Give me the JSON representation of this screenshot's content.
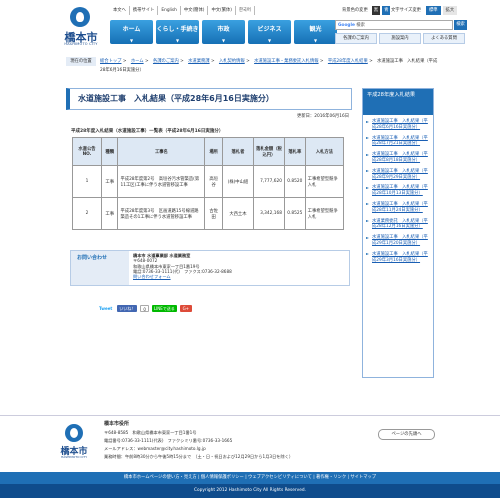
{
  "header": {
    "logo_name": "橋本市",
    "logo_en": "HASHIMOTO CITY",
    "toplinks": [
      "本文へ",
      "携帯サイト",
      "English",
      "中文(簡体)",
      "中文(繁体)",
      "한국어",
      "背景色の変更",
      "黒",
      "青",
      "文字サイズ変更",
      "標準",
      "拡大"
    ],
    "nav": [
      {
        "label": "ホーム",
        "sub": "▼"
      },
      {
        "label": "くらし・手続き",
        "sub": "▼"
      },
      {
        "label": "市政",
        "sub": "▼"
      },
      {
        "label": "ビジネス",
        "sub": "▼"
      },
      {
        "label": "観光",
        "sub": "▼"
      }
    ],
    "search_brand": "Google",
    "search_sub": "検索",
    "search_button": "検索",
    "quick_links": [
      "各課のご案内",
      "施設案内",
      "よくある質問"
    ]
  },
  "breadcrumb": {
    "label": "現在の位置",
    "items": [
      "総合トップ",
      ">",
      "ホーム",
      ">",
      "各課のご案内",
      ">",
      "水道業務課",
      ">",
      "入札契約情報",
      ">",
      "水道施設工事・業務委託入札情報",
      ">",
      "平成28年度入札結果",
      ">",
      "水道施設工事　入札結果（平成28年6月16日実施分）"
    ]
  },
  "main": {
    "title": "水道施設工事　入札結果（平成28年6月16日実施分）",
    "updated": "更新日：2016年06月16日",
    "caption": "平成28年度入札結果（水道施設工事）一覧表（平成28年6月16日実施分）",
    "table": {
      "headers": [
        "水道公告NO.",
        "種類",
        "工事名",
        "場所",
        "落札者",
        "落札金額（税込円）",
        "落札率",
        "入札方法"
      ],
      "rows": [
        [
          "1",
          "工事",
          "平成28年度第2号　高垣谷汚水管築造(第11工区)工事に伴う水道管移設工事",
          "高垣谷",
          "(株)中山組",
          "7,777,620",
          "0.8520",
          "工事希望型競争入札"
        ],
        [
          "2",
          "工事",
          "平成28年度第3号　区画道路15号線道路築造その1工事に伴う水道管移設工事",
          "古佐田",
          "大西土木",
          "3,342,168",
          "0.8525",
          "工事希望型競争入札"
        ]
      ]
    },
    "contact": {
      "heading": "お問い合わせ",
      "dept": "橋本市 水道事業部 水道業務室",
      "zip": "〒648-0072",
      "address": "和歌山県橋本市東家一丁目1番19号",
      "tel": "電話:0736-33-1111(代)　ファクス:0736-32-8688",
      "form": "問い合わせフォーム"
    },
    "social": {
      "tweet": "Tweet",
      "like": "いいね！",
      "count": "0",
      "line": "LINEで送る",
      "plus": "G+"
    }
  },
  "sidebar": {
    "title": "平成28年度入札結果",
    "items": [
      "水道施設工事　入札結果（平成28年6月16日実施分）",
      "水道施設工事　入札結果（平成28年7月21日実施分）",
      "水道施設工事　入札結果（平成28年8月18日実施分）",
      "水道施設工事　入札結果（平成28年9月29日実施分）",
      "水道施設工事　入札結果（平成28年10月13日実施分）",
      "水道施設工事　入札結果（平成28年11月24日実施分）",
      "水道業務委託　入札結果（平成28年12月16日実施分）",
      "水道施設工事　入札結果（平成29年1月20日実施分）",
      "水道施設工事　入札結果（平成29年3月16日実施分）"
    ]
  },
  "footer": {
    "logo_name": "橋本市",
    "logo_en": "HASHIMOTO CITY",
    "title": "橋本市役所",
    "address": "〒648-8585　和歌山県橋本市東家一丁目1番1号",
    "tel": "電話番号:0736-33-1111(代表)　ファクシミリ番号:0736-33-1665",
    "mail": "メールアドレス：webmaster@city.hashimoto.lg.jp",
    "hours": "業務時間：午前8時30分から午後5時15分まで　（土・日・祝日および12月29日から1月3日を除く）",
    "to_top": "ページの先頭へ",
    "nav": "橋本市ホームページの使い方・見え方 | 個人情報保護ポリシー | ウェブアクセシビリティについて | 著作権・リンク | サイトマップ",
    "copyright": "Copyright 2012 Hashimoto City All Rights Reserved."
  }
}
